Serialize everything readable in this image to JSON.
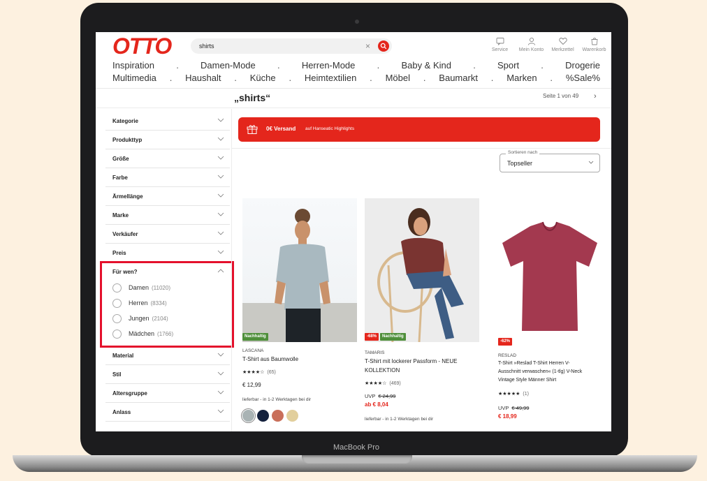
{
  "device": {
    "label": "MacBook Pro"
  },
  "header": {
    "logo": "OTTO",
    "search": {
      "value": "shirts",
      "clear": "×"
    },
    "utilities": [
      {
        "label": "Service",
        "icon": "service-icon"
      },
      {
        "label": "Mein Konto",
        "icon": "user-icon"
      },
      {
        "label": "Merkzettel",
        "icon": "heart-icon"
      },
      {
        "label": "Warenkorb",
        "icon": "cart-icon"
      }
    ],
    "nav_row1": [
      "Inspiration",
      "Damen-Mode",
      "Herren-Mode",
      "Baby & Kind",
      "Sport",
      "Drogerie"
    ],
    "nav_row2": [
      "Multimedia",
      "Haushalt",
      "Küche",
      "Heimtextilien",
      "Möbel",
      "Baumarkt",
      "Marken",
      "%Sale%"
    ],
    "nav_separator": "."
  },
  "results": {
    "title": "„shirts“",
    "pager": "Seite 1 von 49",
    "pager_next": "›"
  },
  "filters": {
    "top": [
      "Kategorie",
      "Produkttyp",
      "Größe",
      "Farbe",
      "Ärmellänge",
      "Marke",
      "Verkäufer",
      "Preis"
    ],
    "open": {
      "label": "Für wen?",
      "options": [
        {
          "label": "Damen",
          "count": "(11020)"
        },
        {
          "label": "Herren",
          "count": "(8334)"
        },
        {
          "label": "Jungen",
          "count": "(2104)"
        },
        {
          "label": "Mädchen",
          "count": "(1766)"
        }
      ]
    },
    "bottom": [
      "Material",
      "Stil",
      "Altersgruppe",
      "Anlass"
    ]
  },
  "banner": {
    "main": "0€ Versand",
    "sub": "auf Hanseatic Highlights"
  },
  "sort": {
    "label": "Sortieren nach",
    "value": "Topseller"
  },
  "products": [
    {
      "brand": "LASCANA",
      "name": "T-Shirt aus Baumwolle",
      "badges": [
        "Nachhaltig"
      ],
      "stars": "★★★★☆",
      "reviews": "(65)",
      "price": "€ 12,99",
      "delivery": "lieferbar - in 1-2 Werktagen bei dir",
      "swatches": [
        "#a9b3b4",
        "#14213d",
        "#c96f5a",
        "#e2cf9c"
      ]
    },
    {
      "brand": "TAMARIS",
      "name_line1": "T-Shirt mit lockerer Passform - NEUE",
      "name_line2": "KOLLEKTION",
      "badges": [
        "-68%",
        "Nachhaltig"
      ],
      "stars": "★★★★☆",
      "reviews": "(469)",
      "uvp_label": "UVP",
      "uvp": "€ 24,99",
      "sale": "ab € 8,04",
      "delivery": "lieferbar - in 1-2 Werktagen bei dir"
    },
    {
      "brand": "RESLAD",
      "name_line1": "T-Shirt »Reslad T-Shirt Herren V-",
      "name_line2": "Ausschnitt verwaschen« (1-tlg) V-Neck",
      "name_line3": "Vintage Style Männer Shirt",
      "badges": [
        "-62%"
      ],
      "stars": "★★★★★",
      "reviews": "(1)",
      "uvp_label": "UVP",
      "uvp": "€ 49,99",
      "sale": "€ 18,99"
    }
  ],
  "colors": {
    "brand_red": "#e4261c",
    "highlight": "#e4102c",
    "sustain_green": "#4f8f3b"
  }
}
